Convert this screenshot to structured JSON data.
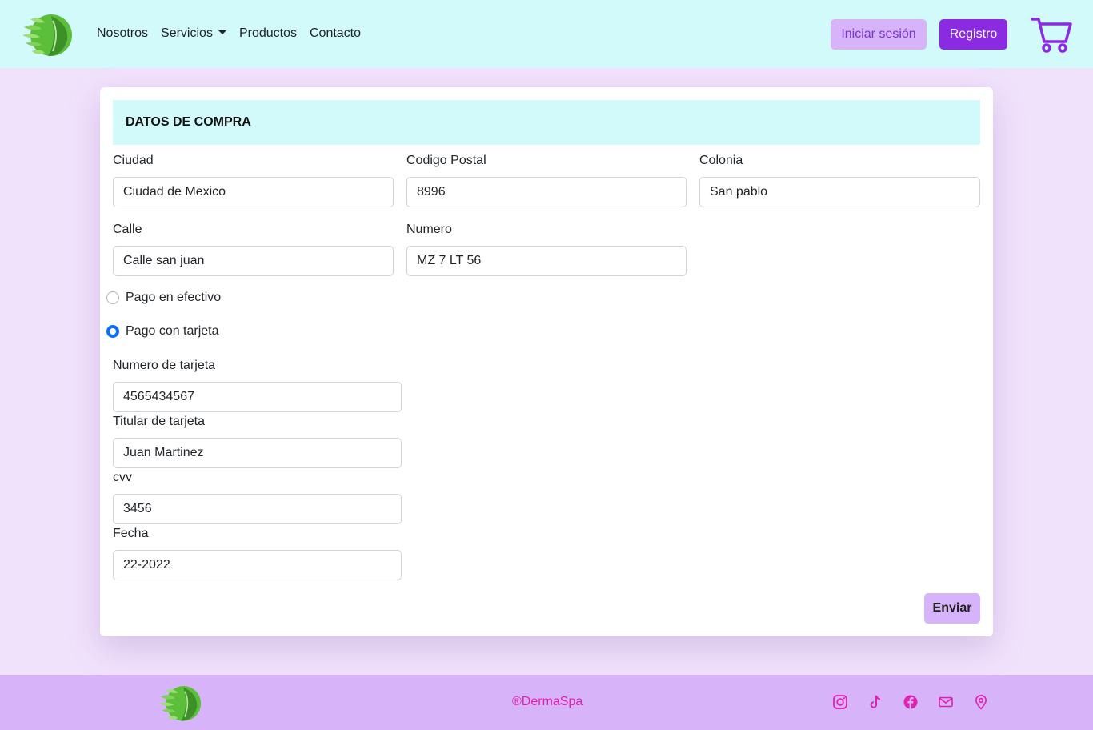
{
  "nav": {
    "links": [
      "Nosotros",
      "Servicios",
      "Productos",
      "Contacto"
    ],
    "login_label": "Iniciar sesión",
    "register_label": "Registro"
  },
  "form": {
    "header": "DATOS DE COMPRA",
    "ciudad_label": "Ciudad",
    "ciudad_value": "Ciudad de Mexico",
    "cp_label": "Codigo Postal",
    "cp_value": "8996",
    "colonia_label": "Colonia",
    "colonia_value": "San pablo",
    "calle_label": "Calle",
    "calle_value": "Calle san juan",
    "numero_label": "Numero",
    "numero_value": "MZ 7 LT 56",
    "pago_efectivo_label": "Pago en efectivo",
    "pago_tarjeta_label": "Pago con tarjeta",
    "tarjeta_label": "Numero de tarjeta",
    "tarjeta_value": "4565434567",
    "titular_label": "Titular de tarjeta",
    "titular_value": "Juan Martinez",
    "cvv_label": "cvv",
    "cvv_value": "3456",
    "fecha_label": "Fecha",
    "fecha_value": "22-2022",
    "submit_label": "Enviar",
    "selected_payment": "tarjeta"
  },
  "footer": {
    "brand": "®DermaSpa",
    "social_icons": [
      "instagram-icon",
      "tiktok-icon",
      "facebook-icon",
      "mail-icon",
      "location-icon"
    ]
  },
  "colors": {
    "navbar_bg": "#d2fafa",
    "page_bg": "#f1e2fc",
    "accent_purple": "#8a2be2",
    "light_purple": "#d7b3f9",
    "footer_text": "#e020b0"
  }
}
